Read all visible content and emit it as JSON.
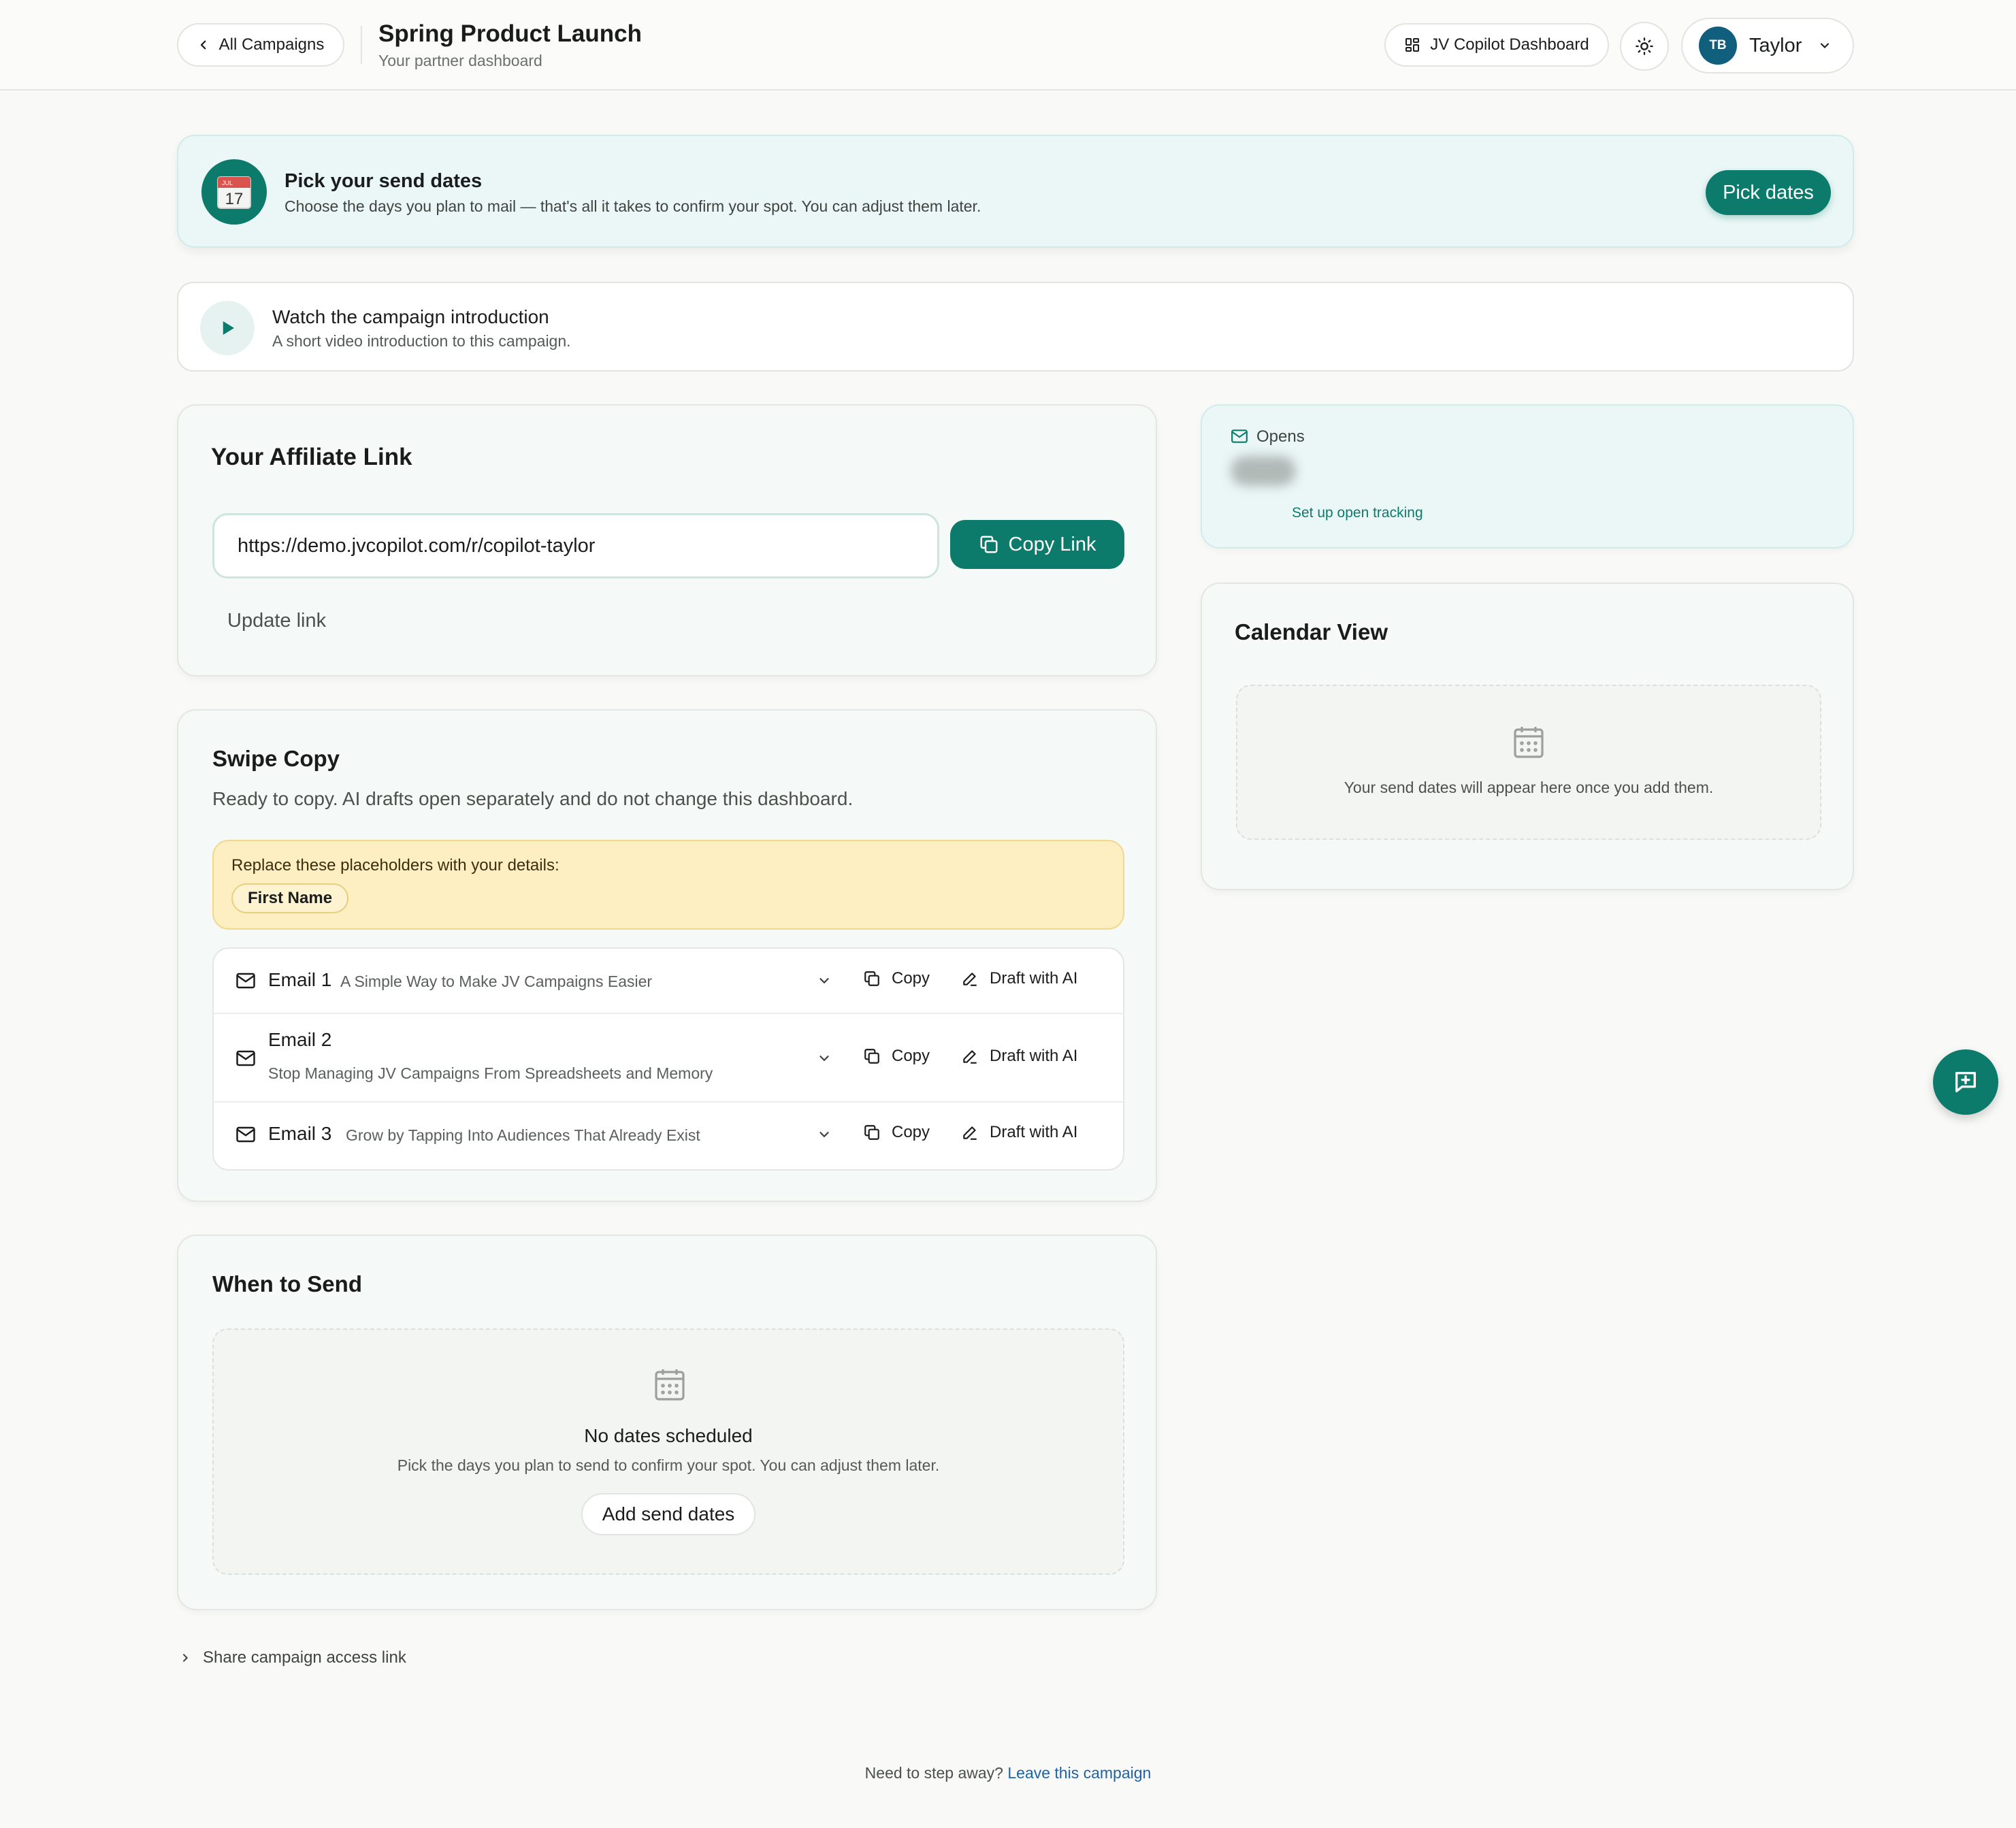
{
  "header": {
    "back_label": "All Campaigns",
    "title": "Spring Product Launch",
    "subtitle": "Your partner dashboard",
    "dashboard_label": "JV Copilot Dashboard",
    "user_initials": "TB",
    "user_name": "Taylor"
  },
  "banner": {
    "title": "Pick your send dates",
    "description": "Choose the days you plan to mail — that's all it takes to confirm your spot. You can adjust them later.",
    "button": "Pick dates",
    "icon_month": "JUL",
    "icon_day": "17"
  },
  "video": {
    "title": "Watch the campaign introduction",
    "description": "A short video introduction to this campaign."
  },
  "affiliate": {
    "title": "Your Affiliate Link",
    "url": "https://demo.jvcopilot.com/r/copilot-taylor",
    "copy_button": "Copy Link",
    "update_link": "Update link"
  },
  "swipe": {
    "title": "Swipe Copy",
    "description": "Ready to copy. AI drafts open separately and do not change this dashboard.",
    "placeholders_title": "Replace these placeholders with your details:",
    "placeholders": [
      "First Name"
    ],
    "emails": [
      {
        "name": "Email 1",
        "subject": "A Simple Way to Make JV Campaigns Easier",
        "copy": "Copy",
        "draft": "Draft with AI"
      },
      {
        "name": "Email 2",
        "subject": "Stop Managing JV Campaigns From Spreadsheets and Memory",
        "copy": "Copy",
        "draft": "Draft with AI"
      },
      {
        "name": "Email 3",
        "subject": "Grow by Tapping Into Audiences That Already Exist",
        "copy": "Copy",
        "draft": "Draft with AI"
      }
    ]
  },
  "when": {
    "title": "When to Send",
    "empty_title": "No dates scheduled",
    "empty_desc": "Pick the days you plan to send to confirm your spot. You can adjust them later.",
    "button": "Add send dates"
  },
  "opens": {
    "label": "Opens",
    "setup_link": "Set up open tracking"
  },
  "calendar": {
    "title": "Calendar View",
    "empty": "Your send dates will appear here once you add them."
  },
  "share": {
    "label": "Share campaign access link"
  },
  "footer": {
    "text": "Need to step away?",
    "link": "Leave this campaign"
  },
  "colors": {
    "accent": "#0d7b6b",
    "banner_bg": "#eaf7f6",
    "placeholder_bg": "#fdefc2",
    "link": "#1d63a8"
  }
}
